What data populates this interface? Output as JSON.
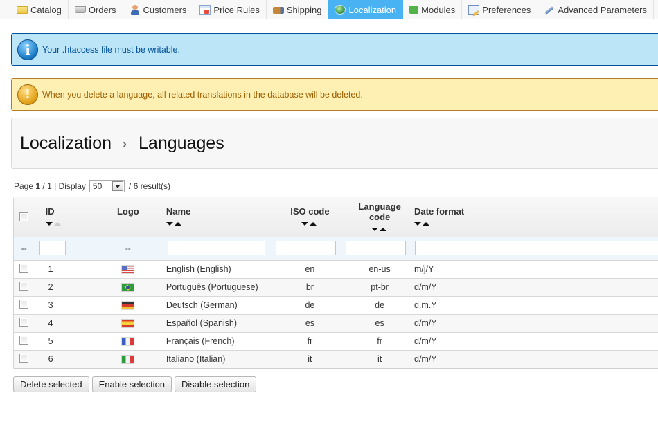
{
  "nav": {
    "tabs": [
      {
        "label": "Catalog",
        "icon": "folder-icon",
        "active": false
      },
      {
        "label": "Orders",
        "icon": "cart-icon",
        "active": false
      },
      {
        "label": "Customers",
        "icon": "user-icon",
        "active": false
      },
      {
        "label": "Price Rules",
        "icon": "price-tag-icon",
        "active": false
      },
      {
        "label": "Shipping",
        "icon": "truck-icon",
        "active": false
      },
      {
        "label": "Localization",
        "icon": "globe-icon",
        "active": true
      },
      {
        "label": "Modules",
        "icon": "puzzle-icon",
        "active": false
      },
      {
        "label": "Preferences",
        "icon": "preferences-icon",
        "active": false
      },
      {
        "label": "Advanced Parameters",
        "icon": "wrench-icon",
        "active": false
      }
    ]
  },
  "alerts": {
    "info": {
      "icon": "info-icon",
      "text": "Your .htaccess file must be writable.",
      "glyph": "i"
    },
    "warning": {
      "icon": "warning-icon",
      "text": "When you delete a language, all related translations in the database will be deleted.",
      "glyph": "!"
    }
  },
  "breadcrumb": {
    "parent": "Localization",
    "separator": "›",
    "current": "Languages"
  },
  "pagination": {
    "page_label": "Page",
    "current_page": "1",
    "page_sep": "/",
    "total_pages": "1",
    "display_label": "| Display",
    "per_page": "50",
    "results": "/ 6 result(s)"
  },
  "table": {
    "columns": {
      "id": "ID",
      "logo": "Logo",
      "name": "Name",
      "iso": "ISO code",
      "lang_code_1": "Language",
      "lang_code_2": "code",
      "date_format": "Date format"
    },
    "filter": {
      "select_placeholder": "--",
      "logo_placeholder": "--",
      "id_value": "",
      "name_value": "",
      "iso_value": "",
      "lang_code_value": "",
      "date_format_value": ""
    },
    "rows": [
      {
        "id": "1",
        "flag": "us",
        "name": "English (English)",
        "iso": "en",
        "lang_code": "en-us",
        "date_format": "m/j/Y"
      },
      {
        "id": "2",
        "flag": "br",
        "name": "Português (Portuguese)",
        "iso": "br",
        "lang_code": "pt-br",
        "date_format": "d/m/Y"
      },
      {
        "id": "3",
        "flag": "de",
        "name": "Deutsch (German)",
        "iso": "de",
        "lang_code": "de",
        "date_format": "d.m.Y"
      },
      {
        "id": "4",
        "flag": "es",
        "name": "Español (Spanish)",
        "iso": "es",
        "lang_code": "es",
        "date_format": "d/m/Y"
      },
      {
        "id": "5",
        "flag": "fr",
        "name": "Français (French)",
        "iso": "fr",
        "lang_code": "fr",
        "date_format": "d/m/Y"
      },
      {
        "id": "6",
        "flag": "it",
        "name": "Italiano (Italian)",
        "iso": "it",
        "lang_code": "it",
        "date_format": "d/m/Y"
      }
    ]
  },
  "actions": {
    "delete": "Delete selected",
    "enable": "Enable selection",
    "disable": "Disable selection"
  },
  "colors": {
    "active_tab": "#49b2f2",
    "info_bg": "#bde5f8",
    "info_border": "#00529b",
    "warning_bg": "#feefb3",
    "warning_border": "#b57c2a"
  }
}
